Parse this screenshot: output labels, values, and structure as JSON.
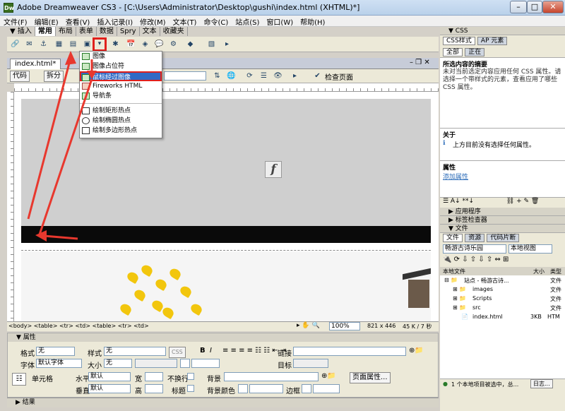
{
  "window": {
    "title": "Adobe Dreamweaver CS3 - [C:\\Users\\Administrator\\Desktop\\gushi\\index.html (XHTML)*]",
    "app_icon": "Dw",
    "min": "–",
    "max": "□",
    "close": "✕"
  },
  "menu": [
    "文件(F)",
    "编辑(E)",
    "查看(V)",
    "插入记录(I)",
    "修改(M)",
    "文本(T)",
    "命令(C)",
    "站点(S)",
    "窗口(W)",
    "帮助(H)"
  ],
  "insert_tabs": [
    "▼ 插入",
    "常用",
    "布局",
    "表单",
    "数据",
    "Spry",
    "文本",
    "收藏夹"
  ],
  "document": {
    "tab": "index.html*",
    "view_buttons": [
      "代码",
      "拆分"
    ],
    "check_page": "检查页面"
  },
  "dropdown": {
    "items": [
      "图像",
      "图像占位符",
      "鼠标经过图像",
      "Fireworks HTML",
      "导航条",
      "绘制矩形热点",
      "绘制椭圆热点",
      "绘制多边形热点"
    ],
    "selected_index": 2
  },
  "statusbar": {
    "tag_path": "<body> <table> <tr> <td> <table> <tr> <td>",
    "zoom": "100%",
    "size": "821 x 446",
    "weight": "45 K / 7 秒"
  },
  "properties": {
    "header": "▼ 属性",
    "format_label": "格式",
    "format_value": "无",
    "style_label": "样式",
    "style_value": "无",
    "css_button": "CSS",
    "bold": "B",
    "italic": "I",
    "link_label": "链接",
    "font_label": "字体",
    "font_value": "默认字体",
    "size_label": "大小",
    "size_value": "无",
    "target_label": "目标",
    "cell_label": "单元格",
    "horz_label": "水平",
    "horz_value": "默认",
    "vert_label": "垂直",
    "vert_value": "默认",
    "width_label": "宽",
    "height_label": "高",
    "nowrap_label": "不换行",
    "header_label": "标题",
    "bg_label": "背景",
    "bgcolor_label": "背景颜色",
    "border_label": "边框",
    "page_props": "页面属性..."
  },
  "results": "▶ 结果",
  "css_panel": {
    "header": "▼ CSS",
    "tabs": [
      "CSS样式",
      "AP 元素"
    ],
    "mode": [
      "全部",
      "正在"
    ],
    "summary_title": "所选内容的摘要",
    "summary_text": "未对当前选定内容应用任何 CSS 属性。请选择一个带样式的元素，查看应用了哪些 CSS 属性。",
    "about_title": "关于",
    "about_text": "上方目前没有选择任何属性。",
    "props_title": "属性",
    "add_prop": "添加属性"
  },
  "app_panel": "▶ 应用程序",
  "tag_panel": "▶ 标签检查器",
  "files_panel": {
    "header": "▼ 文件",
    "tabs": [
      "文件",
      "资源",
      "代码片断"
    ],
    "site": "畅游古诗乐园",
    "view": "本地视图",
    "columns": [
      "本地文件",
      "大小",
      "类型"
    ],
    "tree": [
      {
        "name": "站点 - 畅游古诗...",
        "size": "",
        "type": "文件"
      },
      {
        "name": "images",
        "size": "",
        "type": "文件"
      },
      {
        "name": "Scripts",
        "size": "",
        "type": "文件"
      },
      {
        "name": "src",
        "size": "",
        "type": "文件"
      },
      {
        "name": "index.html",
        "size": "3KB",
        "type": "HTM"
      }
    ],
    "status": "1 个本地项目被选中，总...",
    "log_button": "日志..."
  }
}
